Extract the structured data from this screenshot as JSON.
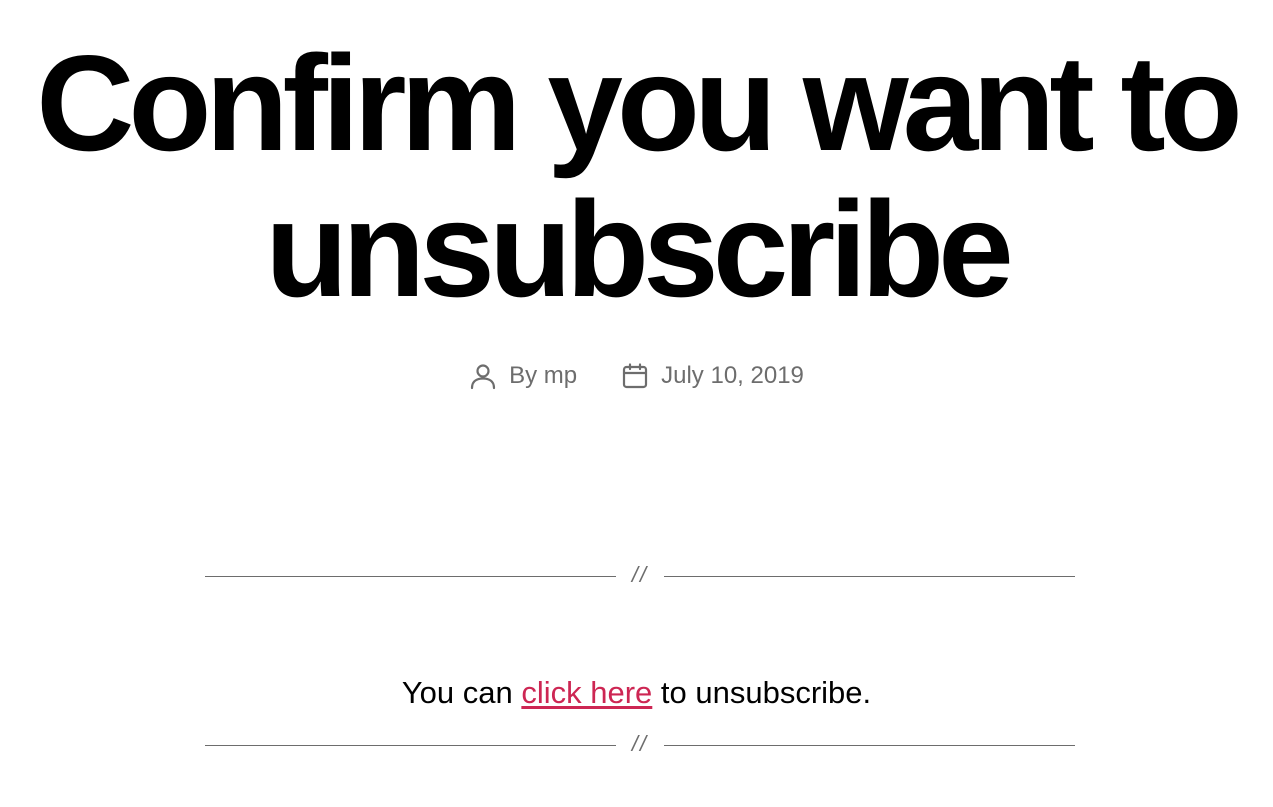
{
  "post": {
    "title": "Confirm you want to unsubscribe",
    "author_prefix": "By",
    "author_name": "mp",
    "date": "July 10, 2019"
  },
  "separator": {
    "symbol": "//"
  },
  "content": {
    "text_before": "You can ",
    "link_label": "click here",
    "text_after": " to unsubscribe."
  },
  "icons": {
    "author": "user-icon",
    "date": "calendar-icon"
  },
  "colors": {
    "text": "#000000",
    "meta": "#6d6d6d",
    "link": "#cd2653"
  }
}
